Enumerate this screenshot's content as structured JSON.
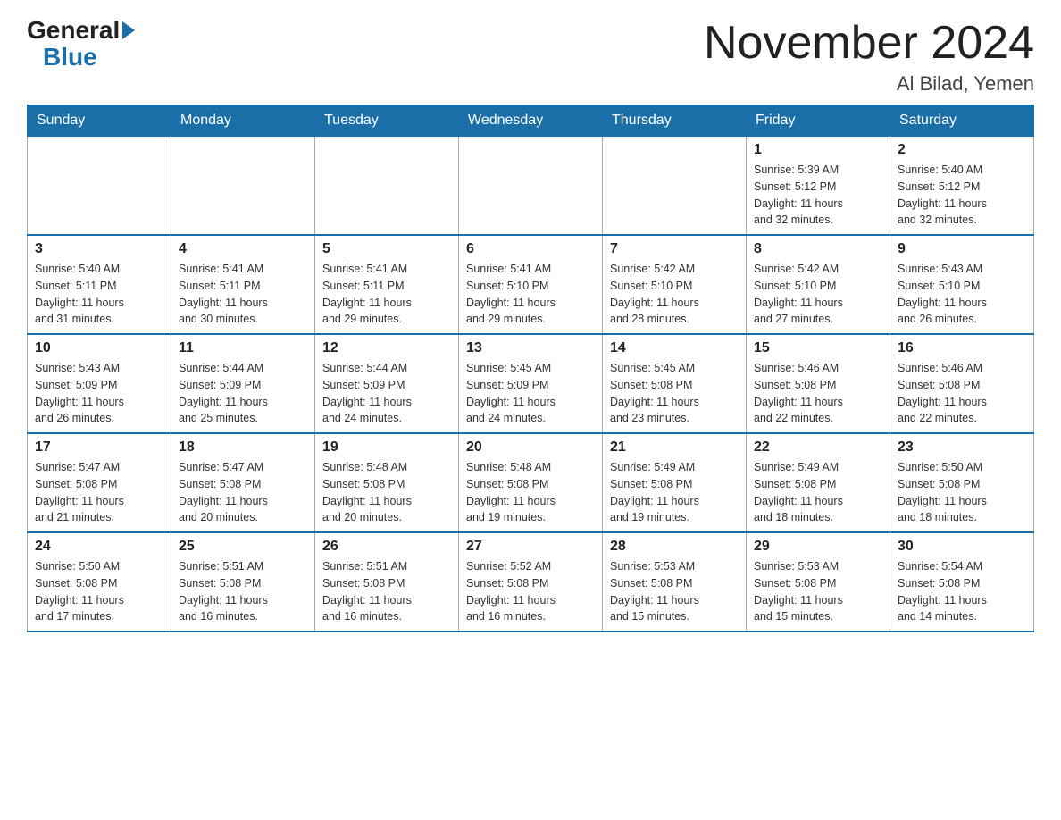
{
  "logo": {
    "text1": "General",
    "text2": "Blue"
  },
  "title": "November 2024",
  "subtitle": "Al Bilad, Yemen",
  "weekdays": [
    "Sunday",
    "Monday",
    "Tuesday",
    "Wednesday",
    "Thursday",
    "Friday",
    "Saturday"
  ],
  "weeks": [
    [
      {
        "day": "",
        "info": ""
      },
      {
        "day": "",
        "info": ""
      },
      {
        "day": "",
        "info": ""
      },
      {
        "day": "",
        "info": ""
      },
      {
        "day": "",
        "info": ""
      },
      {
        "day": "1",
        "info": "Sunrise: 5:39 AM\nSunset: 5:12 PM\nDaylight: 11 hours\nand 32 minutes."
      },
      {
        "day": "2",
        "info": "Sunrise: 5:40 AM\nSunset: 5:12 PM\nDaylight: 11 hours\nand 32 minutes."
      }
    ],
    [
      {
        "day": "3",
        "info": "Sunrise: 5:40 AM\nSunset: 5:11 PM\nDaylight: 11 hours\nand 31 minutes."
      },
      {
        "day": "4",
        "info": "Sunrise: 5:41 AM\nSunset: 5:11 PM\nDaylight: 11 hours\nand 30 minutes."
      },
      {
        "day": "5",
        "info": "Sunrise: 5:41 AM\nSunset: 5:11 PM\nDaylight: 11 hours\nand 29 minutes."
      },
      {
        "day": "6",
        "info": "Sunrise: 5:41 AM\nSunset: 5:10 PM\nDaylight: 11 hours\nand 29 minutes."
      },
      {
        "day": "7",
        "info": "Sunrise: 5:42 AM\nSunset: 5:10 PM\nDaylight: 11 hours\nand 28 minutes."
      },
      {
        "day": "8",
        "info": "Sunrise: 5:42 AM\nSunset: 5:10 PM\nDaylight: 11 hours\nand 27 minutes."
      },
      {
        "day": "9",
        "info": "Sunrise: 5:43 AM\nSunset: 5:10 PM\nDaylight: 11 hours\nand 26 minutes."
      }
    ],
    [
      {
        "day": "10",
        "info": "Sunrise: 5:43 AM\nSunset: 5:09 PM\nDaylight: 11 hours\nand 26 minutes."
      },
      {
        "day": "11",
        "info": "Sunrise: 5:44 AM\nSunset: 5:09 PM\nDaylight: 11 hours\nand 25 minutes."
      },
      {
        "day": "12",
        "info": "Sunrise: 5:44 AM\nSunset: 5:09 PM\nDaylight: 11 hours\nand 24 minutes."
      },
      {
        "day": "13",
        "info": "Sunrise: 5:45 AM\nSunset: 5:09 PM\nDaylight: 11 hours\nand 24 minutes."
      },
      {
        "day": "14",
        "info": "Sunrise: 5:45 AM\nSunset: 5:08 PM\nDaylight: 11 hours\nand 23 minutes."
      },
      {
        "day": "15",
        "info": "Sunrise: 5:46 AM\nSunset: 5:08 PM\nDaylight: 11 hours\nand 22 minutes."
      },
      {
        "day": "16",
        "info": "Sunrise: 5:46 AM\nSunset: 5:08 PM\nDaylight: 11 hours\nand 22 minutes."
      }
    ],
    [
      {
        "day": "17",
        "info": "Sunrise: 5:47 AM\nSunset: 5:08 PM\nDaylight: 11 hours\nand 21 minutes."
      },
      {
        "day": "18",
        "info": "Sunrise: 5:47 AM\nSunset: 5:08 PM\nDaylight: 11 hours\nand 20 minutes."
      },
      {
        "day": "19",
        "info": "Sunrise: 5:48 AM\nSunset: 5:08 PM\nDaylight: 11 hours\nand 20 minutes."
      },
      {
        "day": "20",
        "info": "Sunrise: 5:48 AM\nSunset: 5:08 PM\nDaylight: 11 hours\nand 19 minutes."
      },
      {
        "day": "21",
        "info": "Sunrise: 5:49 AM\nSunset: 5:08 PM\nDaylight: 11 hours\nand 19 minutes."
      },
      {
        "day": "22",
        "info": "Sunrise: 5:49 AM\nSunset: 5:08 PM\nDaylight: 11 hours\nand 18 minutes."
      },
      {
        "day": "23",
        "info": "Sunrise: 5:50 AM\nSunset: 5:08 PM\nDaylight: 11 hours\nand 18 minutes."
      }
    ],
    [
      {
        "day": "24",
        "info": "Sunrise: 5:50 AM\nSunset: 5:08 PM\nDaylight: 11 hours\nand 17 minutes."
      },
      {
        "day": "25",
        "info": "Sunrise: 5:51 AM\nSunset: 5:08 PM\nDaylight: 11 hours\nand 16 minutes."
      },
      {
        "day": "26",
        "info": "Sunrise: 5:51 AM\nSunset: 5:08 PM\nDaylight: 11 hours\nand 16 minutes."
      },
      {
        "day": "27",
        "info": "Sunrise: 5:52 AM\nSunset: 5:08 PM\nDaylight: 11 hours\nand 16 minutes."
      },
      {
        "day": "28",
        "info": "Sunrise: 5:53 AM\nSunset: 5:08 PM\nDaylight: 11 hours\nand 15 minutes."
      },
      {
        "day": "29",
        "info": "Sunrise: 5:53 AM\nSunset: 5:08 PM\nDaylight: 11 hours\nand 15 minutes."
      },
      {
        "day": "30",
        "info": "Sunrise: 5:54 AM\nSunset: 5:08 PM\nDaylight: 11 hours\nand 14 minutes."
      }
    ]
  ]
}
